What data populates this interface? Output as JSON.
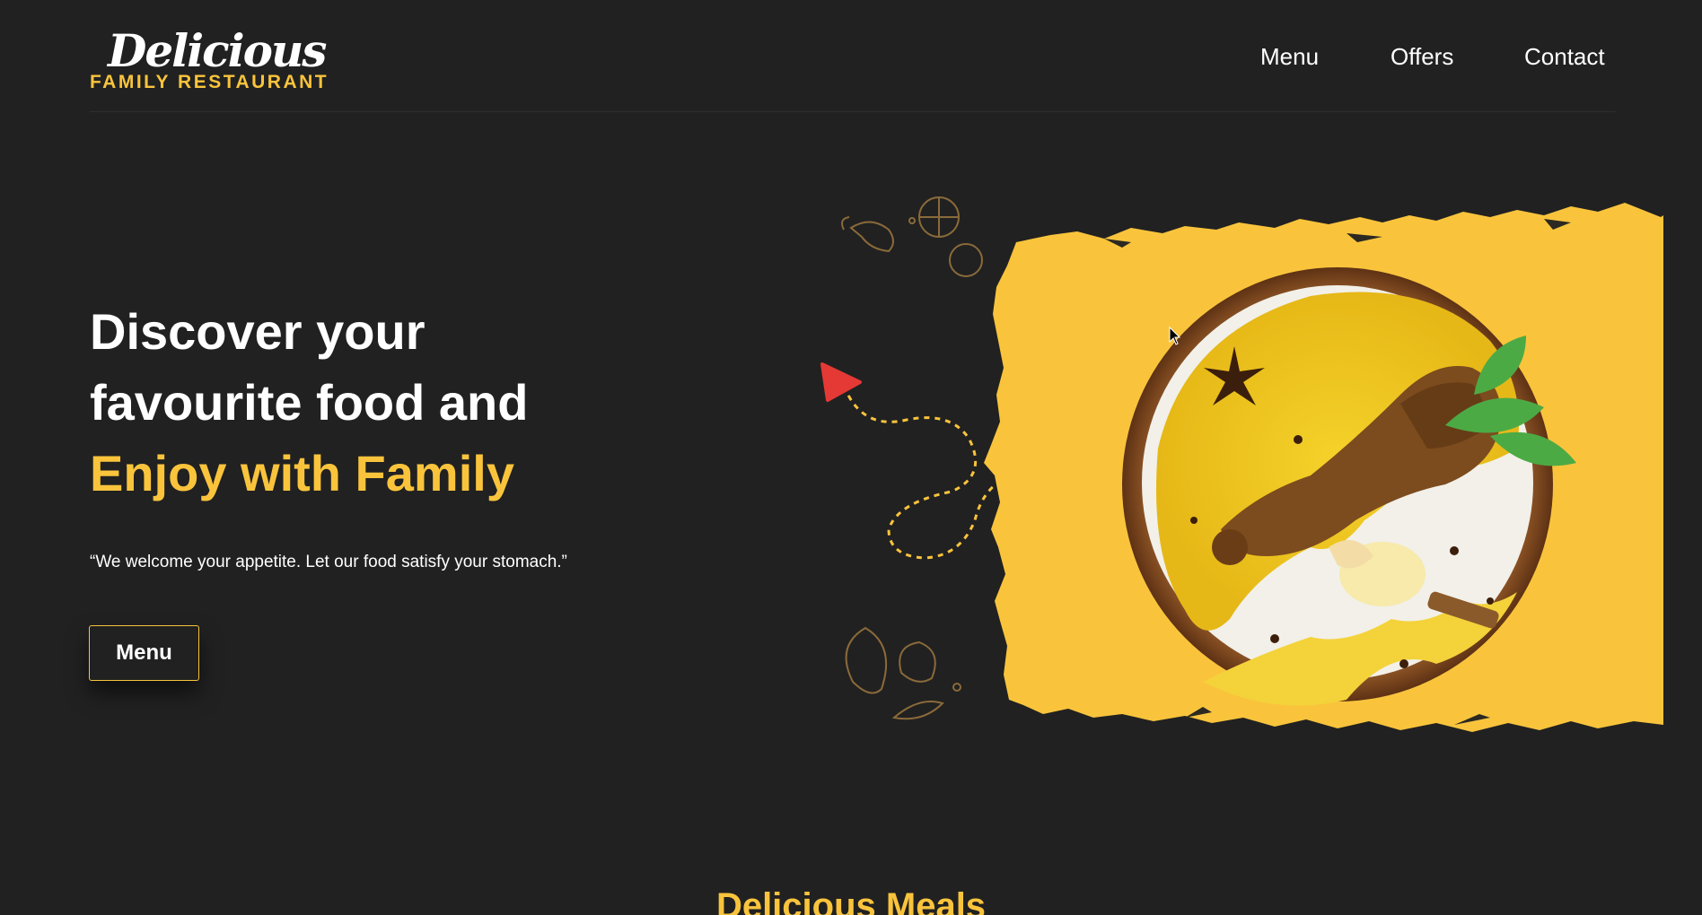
{
  "header": {
    "logo": {
      "script": "Delicious",
      "subtitle": "FAMILY RESTAURANT"
    },
    "nav": [
      {
        "label": "Menu"
      },
      {
        "label": "Offers"
      },
      {
        "label": "Contact"
      }
    ]
  },
  "hero": {
    "title_line1": "Discover your",
    "title_line2": "favourite food and",
    "title_highlight": "Enjoy with Family",
    "quote": "“We welcome your appetite. Let our food satisfy your stomach.”",
    "cta_label": "Menu",
    "image_alt": "Chicken biryani in a wooden bowl"
  },
  "next_section": {
    "heading": "Delicious Meals"
  },
  "colors": {
    "background": "#212121",
    "accent": "#f9c43c",
    "play_red": "#e53935"
  },
  "icons": [
    "play-icon",
    "shrimp-doodle-icon",
    "lemon-doodle-icon",
    "mango-doodle-icon",
    "leaf-doodle-icon"
  ]
}
